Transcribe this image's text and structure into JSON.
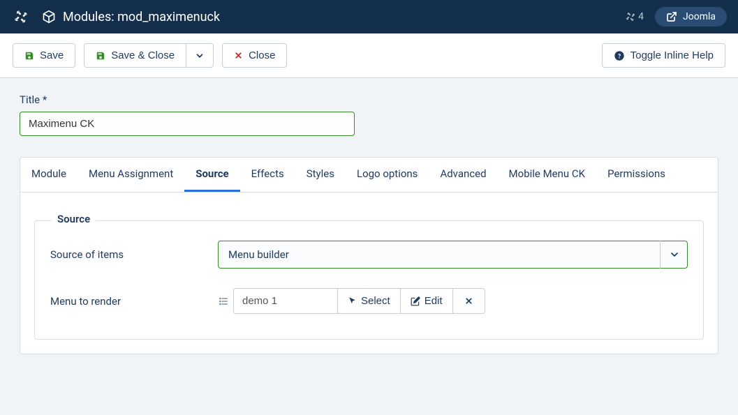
{
  "topbar": {
    "title": "Modules: mod_maximenuck",
    "badge_count": "4",
    "brand_label": "Joomla"
  },
  "toolbar": {
    "save_label": "Save",
    "save_close_label": "Save & Close",
    "close_label": "Close",
    "toggle_help_label": "Toggle Inline Help"
  },
  "title_field": {
    "label": "Title *",
    "value": "Maximenu CK"
  },
  "tabs": [
    {
      "label": "Module"
    },
    {
      "label": "Menu Assignment"
    },
    {
      "label": "Source"
    },
    {
      "label": "Effects"
    },
    {
      "label": "Styles"
    },
    {
      "label": "Logo options"
    },
    {
      "label": "Advanced"
    },
    {
      "label": "Mobile Menu CK"
    },
    {
      "label": "Permissions"
    }
  ],
  "active_tab_index": 2,
  "source_panel": {
    "legend": "Source",
    "source_of_items": {
      "label": "Source of items",
      "value": "Menu builder"
    },
    "menu_to_render": {
      "label": "Menu to render",
      "value": "demo 1",
      "select_btn": "Select",
      "edit_btn": "Edit"
    }
  }
}
